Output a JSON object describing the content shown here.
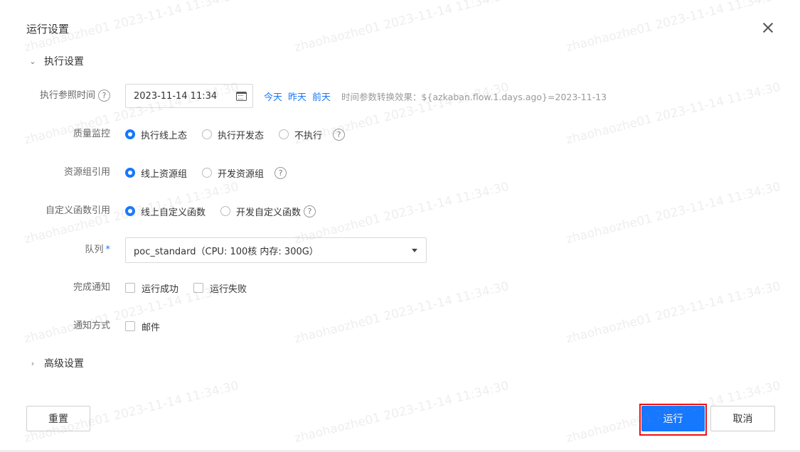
{
  "dialog": {
    "title": "运行设置"
  },
  "exec_section": {
    "label": "执行设置"
  },
  "exec_time": {
    "label": "执行参照时间",
    "help": "?",
    "value": "2023-11-14 11:34",
    "quick": [
      "今天",
      "昨天",
      "前天"
    ],
    "hint": "时间参数转换效果：${azkaban.flow.1.days.ago}=2023-11-13"
  },
  "quality": {
    "label": "质量监控",
    "options": [
      "执行线上态",
      "执行开发态",
      "不执行"
    ],
    "selected": "执行线上态",
    "help": "?"
  },
  "resource": {
    "label": "资源组引用",
    "options": [
      "线上资源组",
      "开发资源组"
    ],
    "selected": "线上资源组",
    "help": "?"
  },
  "udf": {
    "label": "自定义函数引用",
    "options": [
      "线上自定义函数",
      "开发自定义函数"
    ],
    "selected": "线上自定义函数",
    "help": "?"
  },
  "queue": {
    "label": "队列",
    "required_mark": "*",
    "value": "poc_standard（CPU: 100核 内存: 300G）"
  },
  "notify": {
    "label": "完成通知",
    "options": [
      "运行成功",
      "运行失败"
    ]
  },
  "notify_method": {
    "label": "通知方式",
    "options": [
      "邮件"
    ]
  },
  "advanced_section": {
    "label": "高级设置"
  },
  "buttons": {
    "reset": "重置",
    "run": "运行",
    "cancel": "取消"
  },
  "watermark": {
    "text": "zhaohaozhe01 2023-11-14 11:34:30"
  }
}
